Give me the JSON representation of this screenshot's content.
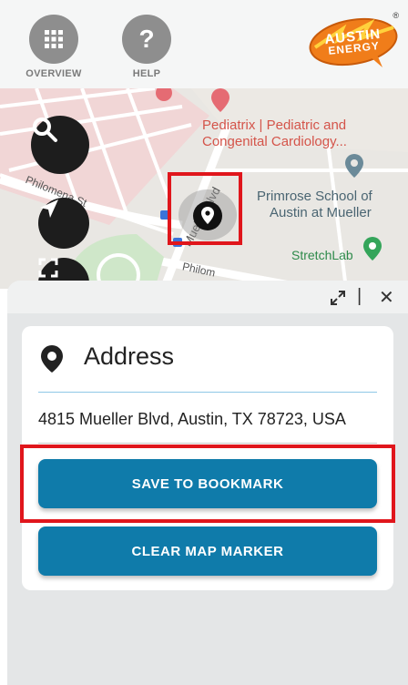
{
  "header": {
    "overview_label": "OVERVIEW",
    "help_label": "HELP",
    "logo_text_line1": "AUSTIN",
    "logo_text_line2": "ENERGY",
    "logo_registered": "®"
  },
  "map": {
    "labels": {
      "pediatrix": "Pediatrix | Pediatric and",
      "pediatrix_line2": "Congenital Cardiology...",
      "primrose": "Primrose School of",
      "primrose_line2": "Austin at Mueller",
      "stretchlab": "StretchLab",
      "philomena_left": "Philomena St",
      "mueller": "Mueller Blvd",
      "philomena_bottom": "Philom"
    },
    "icons": {
      "search": "search-icon",
      "locate": "navigation-arrow-icon",
      "extent": "extent-icon",
      "marker": "location-pin-icon"
    }
  },
  "panel": {
    "expand_icon": "expand-icon",
    "separator": "|",
    "close_glyph": "✕",
    "address_title": "Address",
    "address_value": "4815 Mueller Blvd, Austin, TX 78723, USA",
    "save_button": "SAVE TO BOOKMARK",
    "clear_button": "CLEAR MAP MARKER"
  },
  "colors": {
    "button_blue": "#0f7baa",
    "highlight_red": "#e0161c",
    "logo_orange": "#f07d1a"
  }
}
